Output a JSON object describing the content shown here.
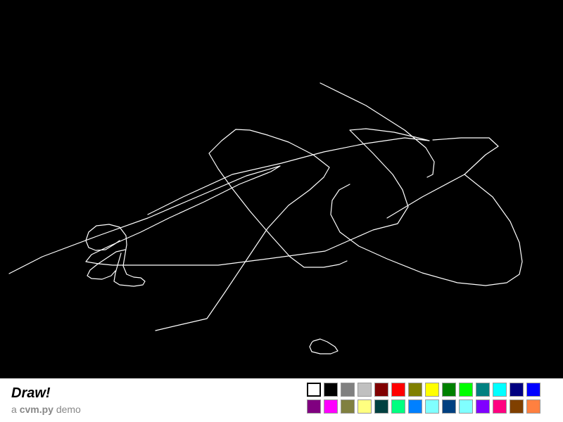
{
  "app": {
    "title": "Draw!",
    "subtitle_prefix": "a ",
    "subtitle_brand": "cvm.py",
    "subtitle_suffix": " demo"
  },
  "canvas": {
    "background": "#000000",
    "stroke_color": "#ffffff"
  },
  "palette": {
    "selected_index": 0,
    "colors": [
      "#ffffff",
      "#000000",
      "#808080",
      "#c0c0c0",
      "#800000",
      "#ff0000",
      "#808000",
      "#ffff00",
      "#008000",
      "#00ff00",
      "#008080",
      "#00ffff",
      "#000080",
      "#0000ff",
      "#800080",
      "#ff00ff",
      "#808040",
      "#ffff80",
      "#004040",
      "#00ff80",
      "#0080ff",
      "#80ffff",
      "#004080",
      "#80ffff",
      "#8000ff",
      "#ff0080",
      "#804000",
      "#ff8040"
    ]
  }
}
